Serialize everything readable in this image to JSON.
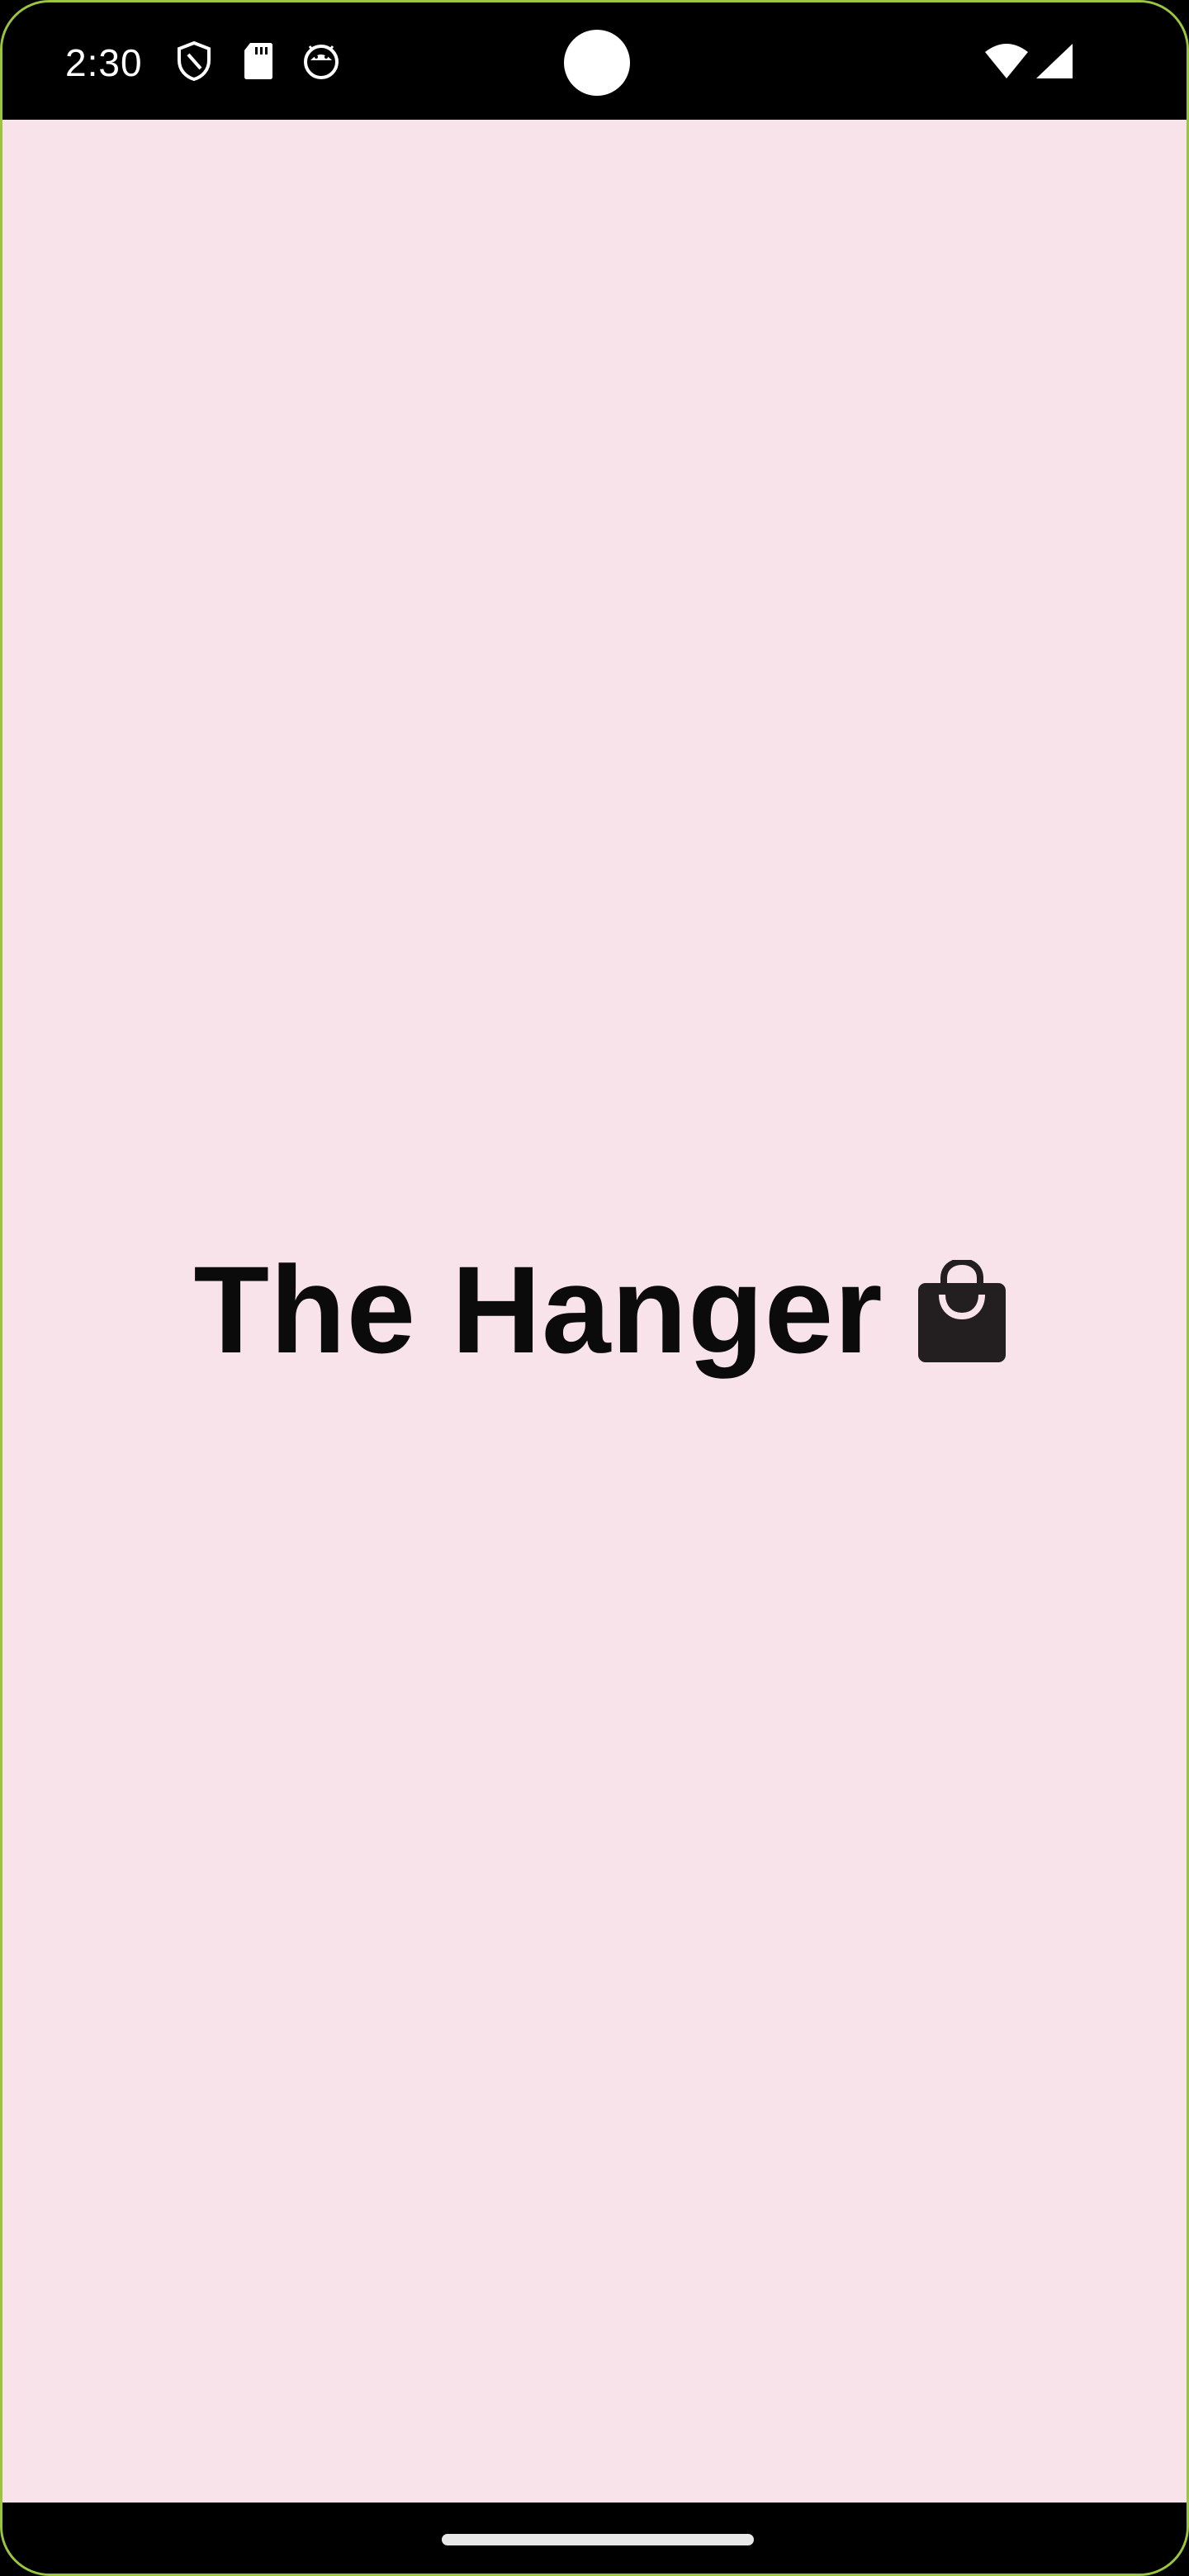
{
  "status_bar": {
    "time": "2:30",
    "icons_left": [
      "shield-icon",
      "sd-card-icon",
      "android-face-icon"
    ],
    "icons_right": [
      "wifi-icon",
      "cellular-signal-icon"
    ]
  },
  "splash": {
    "title": "The Hanger",
    "icon": "shopping-bag-icon",
    "background_color": "#f9e3ea",
    "text_color": "#0b0b0b"
  },
  "navigation": {
    "handle": "home-gesture-handle"
  }
}
